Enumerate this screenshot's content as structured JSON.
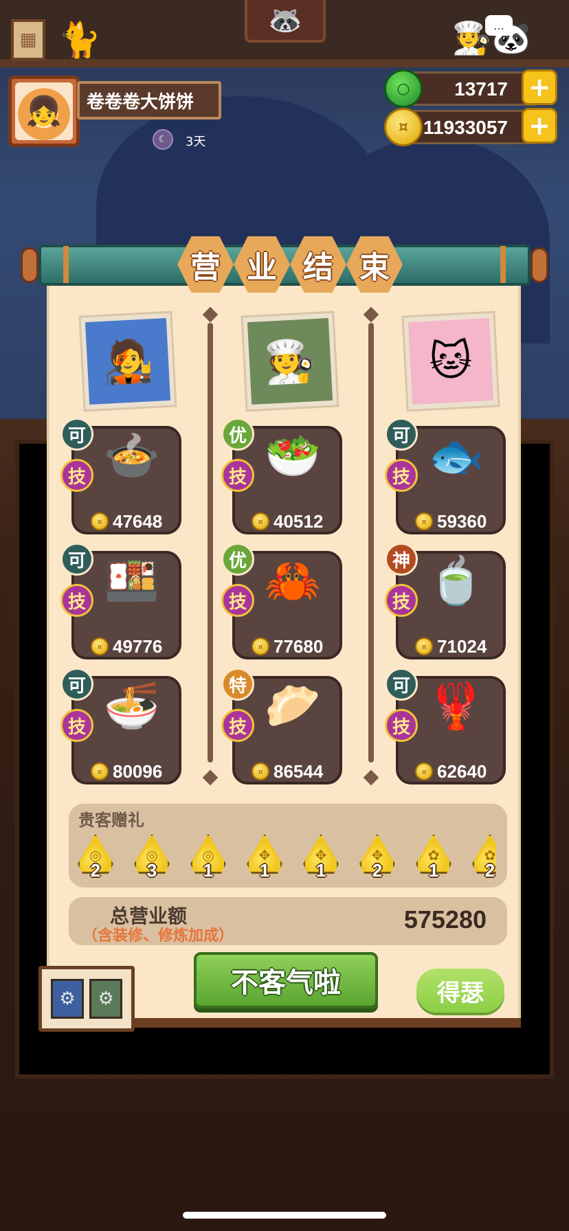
{
  "player": {
    "name": "卷卷卷大饼饼",
    "days": "3天"
  },
  "currency": {
    "jade": "13717",
    "coins": "11933057"
  },
  "title": [
    "营",
    "业",
    "结",
    "束"
  ],
  "columns": [
    {
      "dishes": [
        {
          "grade": "可",
          "skill": "技",
          "price": "47648",
          "art": "🍲"
        },
        {
          "grade": "可",
          "skill": "技",
          "price": "49776",
          "art": "🍱"
        },
        {
          "grade": "可",
          "skill": "技",
          "price": "80096",
          "art": "🍜"
        }
      ]
    },
    {
      "dishes": [
        {
          "grade": "优",
          "skill": "技",
          "price": "40512",
          "art": "🥗"
        },
        {
          "grade": "优",
          "skill": "技",
          "price": "77680",
          "art": "🦀"
        },
        {
          "grade": "特",
          "skill": "技",
          "price": "86544",
          "art": "🥟"
        }
      ]
    },
    {
      "dishes": [
        {
          "grade": "可",
          "skill": "技",
          "price": "59360",
          "art": "🐟"
        },
        {
          "grade": "神",
          "skill": "技",
          "price": "71024",
          "art": "🍵"
        },
        {
          "grade": "可",
          "skill": "技",
          "price": "62640",
          "art": "🦞"
        }
      ]
    }
  ],
  "gifts": {
    "title": "贵客赠礼",
    "items": [
      {
        "count": "2",
        "glyph": "◎"
      },
      {
        "count": "3",
        "glyph": "◎"
      },
      {
        "count": "1",
        "glyph": "◎"
      },
      {
        "count": "1",
        "glyph": "✥"
      },
      {
        "count": "1",
        "glyph": "✥"
      },
      {
        "count": "2",
        "glyph": "✥"
      },
      {
        "count": "1",
        "glyph": "✿"
      },
      {
        "count": "2",
        "glyph": "✿"
      }
    ]
  },
  "total": {
    "label": "总营业额",
    "note": "（含装修、修炼加成）",
    "value": "575280"
  },
  "buttons": {
    "primary": "不客气啦",
    "secondary": "得瑟"
  },
  "colors": {
    "panel": "#fbe7c8",
    "primary_button": "#6ab93a",
    "accent_gold": "#f6c21c"
  },
  "icons": {
    "plus": "+",
    "coin": "¤",
    "jade": "○",
    "mini_left": "⚙",
    "mini_right": "⚙",
    "portraits": [
      "🧑‍🎤",
      "🧑‍🍳",
      "🐱"
    ]
  }
}
